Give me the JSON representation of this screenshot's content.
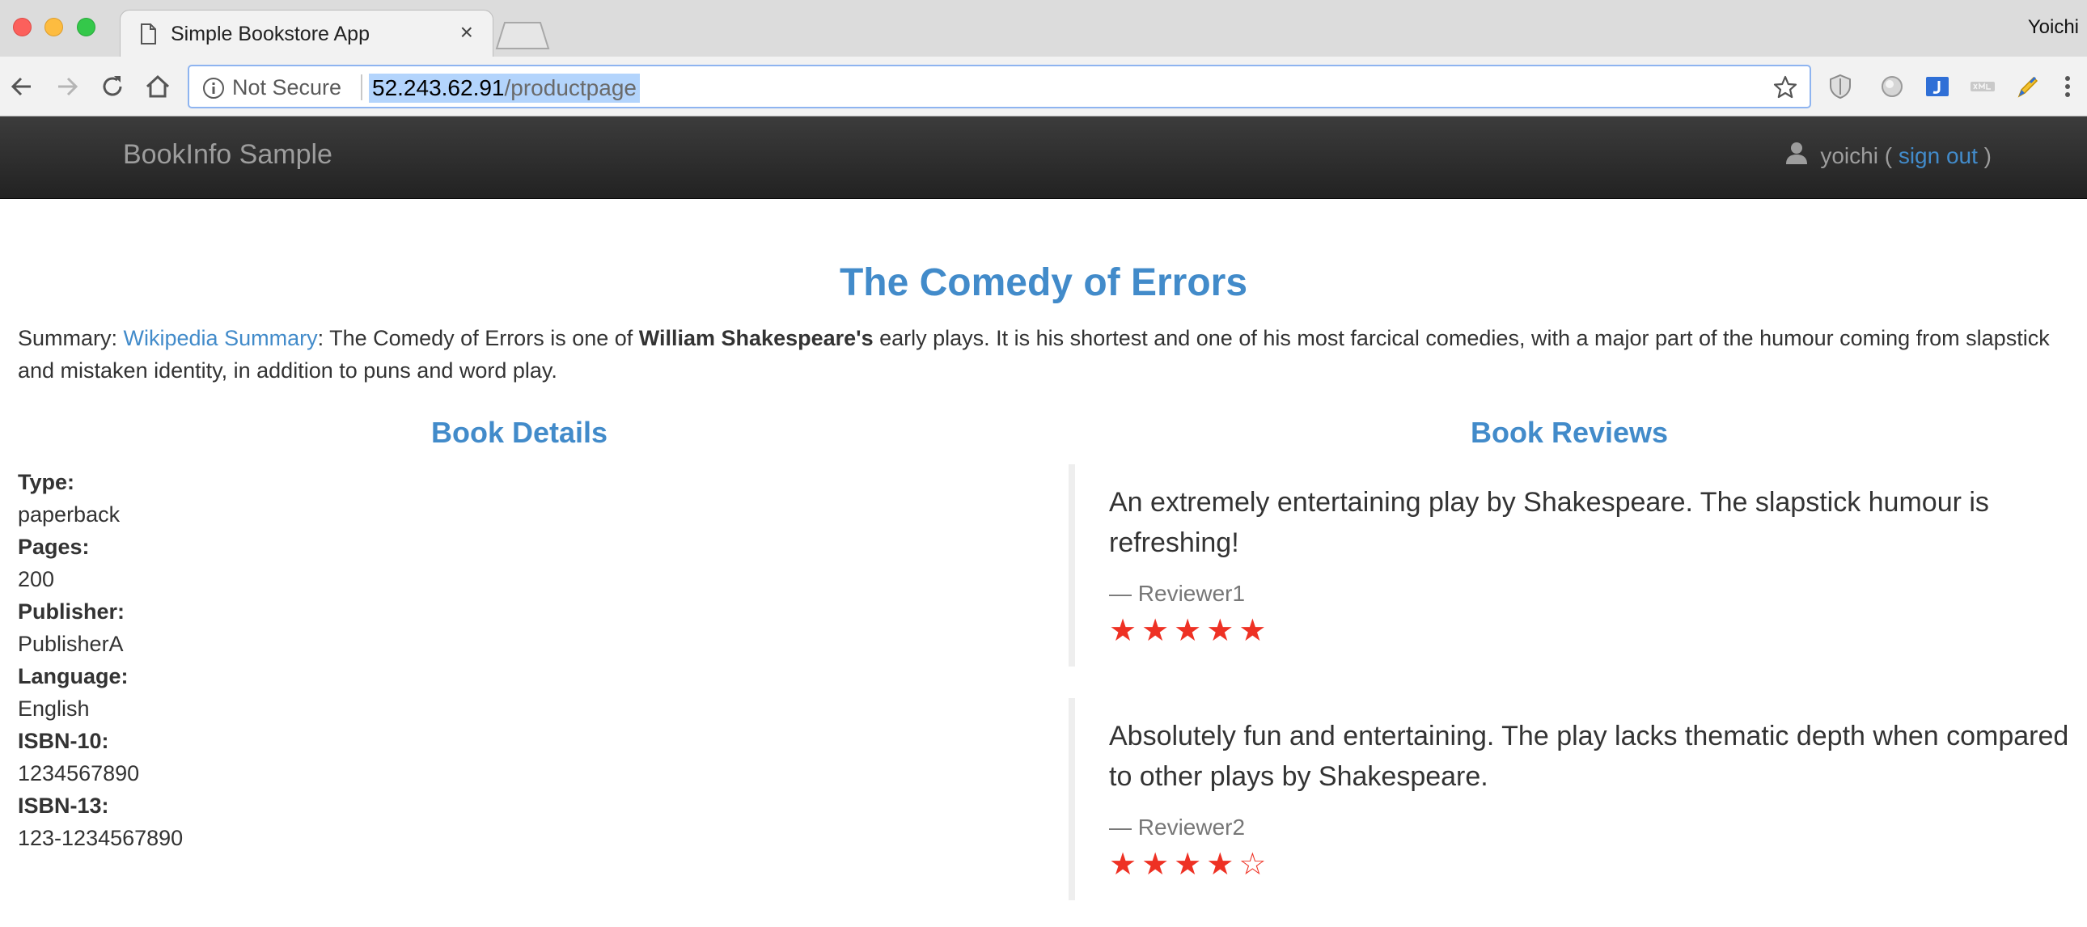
{
  "browser": {
    "tab_title": "Simple Bookstore App",
    "tab_close": "×",
    "profile_name": "Yoichi",
    "security_label": "Not Secure",
    "url_host": "52.243.62.91",
    "url_path": "/productpage"
  },
  "navbar": {
    "brand": "BookInfo Sample",
    "username": "yoichi",
    "paren_open": " ( ",
    "signout": "sign out",
    "paren_close": " )"
  },
  "book": {
    "title": "The Comedy of Errors",
    "summary_prefix": "Summary: ",
    "summary_link": "Wikipedia Summary",
    "summary_part1": ": The Comedy of Errors is one of ",
    "summary_bold": "William Shakespeare's",
    "summary_part2": " early plays. It is his shortest and one of his most farcical comedies, with a major part of the humour coming from slapstick and mistaken identity, in addition to puns and word play."
  },
  "details": {
    "heading": "Book Details",
    "items": [
      {
        "label": "Type:",
        "value": "paperback"
      },
      {
        "label": "Pages:",
        "value": "200"
      },
      {
        "label": "Publisher:",
        "value": "PublisherA"
      },
      {
        "label": "Language:",
        "value": "English"
      },
      {
        "label": "ISBN-10:",
        "value": "1234567890"
      },
      {
        "label": "ISBN-13:",
        "value": "123-1234567890"
      }
    ]
  },
  "reviews": {
    "heading": "Book Reviews",
    "items": [
      {
        "text": "An extremely entertaining play by Shakespeare. The slapstick humour is refreshing!",
        "author": "— Reviewer1",
        "rating": 5,
        "max_rating": 5
      },
      {
        "text": "Absolutely fun and entertaining. The play lacks thematic depth when compared to other plays by Shakespeare.",
        "author": "— Reviewer2",
        "rating": 4,
        "max_rating": 5
      }
    ],
    "star_color": "#ee3124"
  },
  "colors": {
    "link": "#428bca",
    "navbar_bg": "#222222"
  }
}
